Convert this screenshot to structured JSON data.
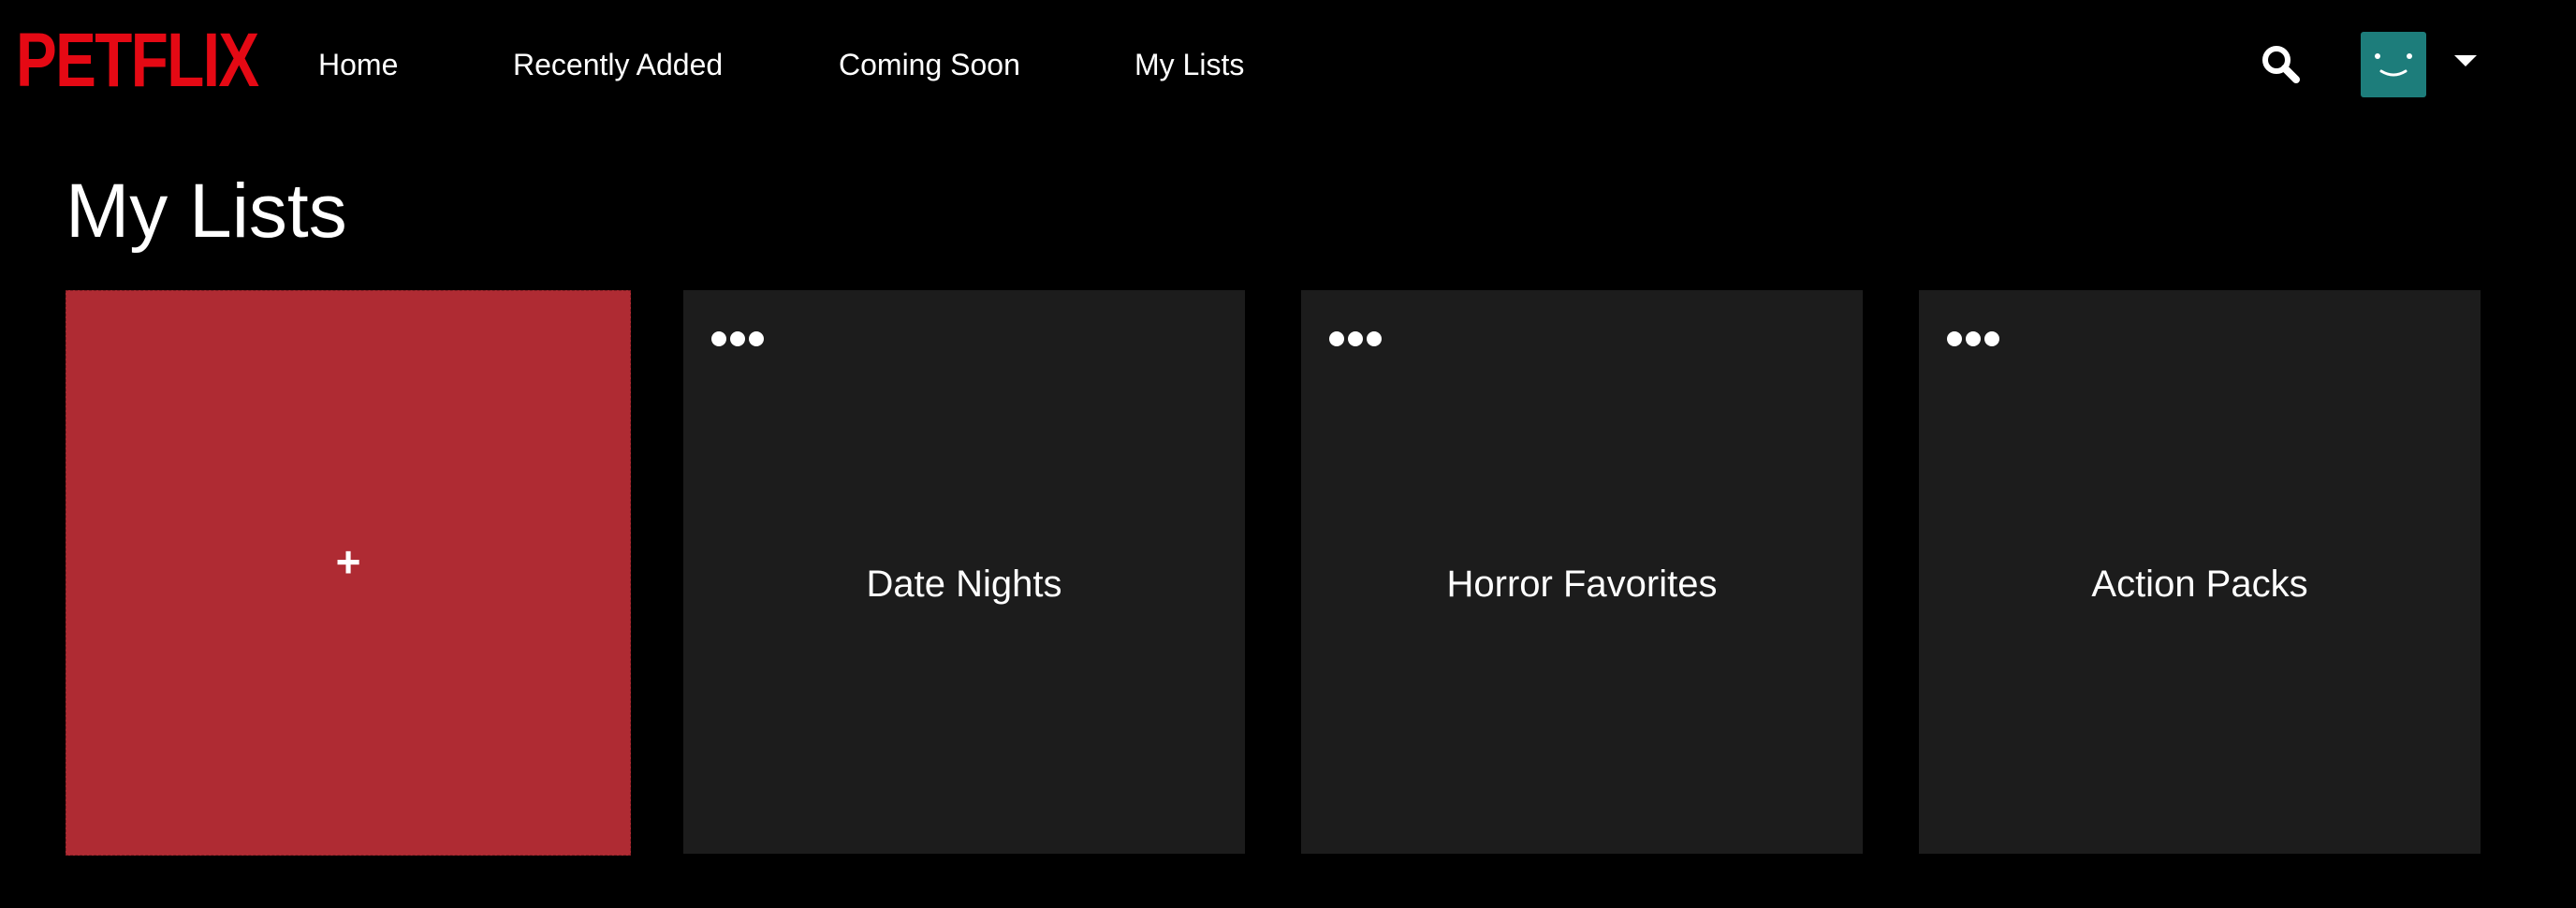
{
  "brand": {
    "logo_text": "PETFLIX",
    "accent_color": "#e50914"
  },
  "nav": {
    "items": [
      {
        "label": "Home"
      },
      {
        "label": "Recently Added"
      },
      {
        "label": "Coming Soon"
      },
      {
        "label": "My Lists"
      }
    ]
  },
  "header": {
    "search_icon": "search-icon",
    "avatar_icon": "smiley-avatar-icon",
    "avatar_color": "#1d7d7b",
    "menu_icon": "caret-down-icon"
  },
  "main": {
    "title": "My Lists",
    "new_list": {
      "icon_text": "+",
      "color": "#af2b33"
    },
    "lists": [
      {
        "label": "Date Nights",
        "menu_icon": "more-dots-icon"
      },
      {
        "label": "Horror Favorites",
        "menu_icon": "more-dots-icon"
      },
      {
        "label": "Action Packs",
        "menu_icon": "more-dots-icon"
      }
    ]
  }
}
